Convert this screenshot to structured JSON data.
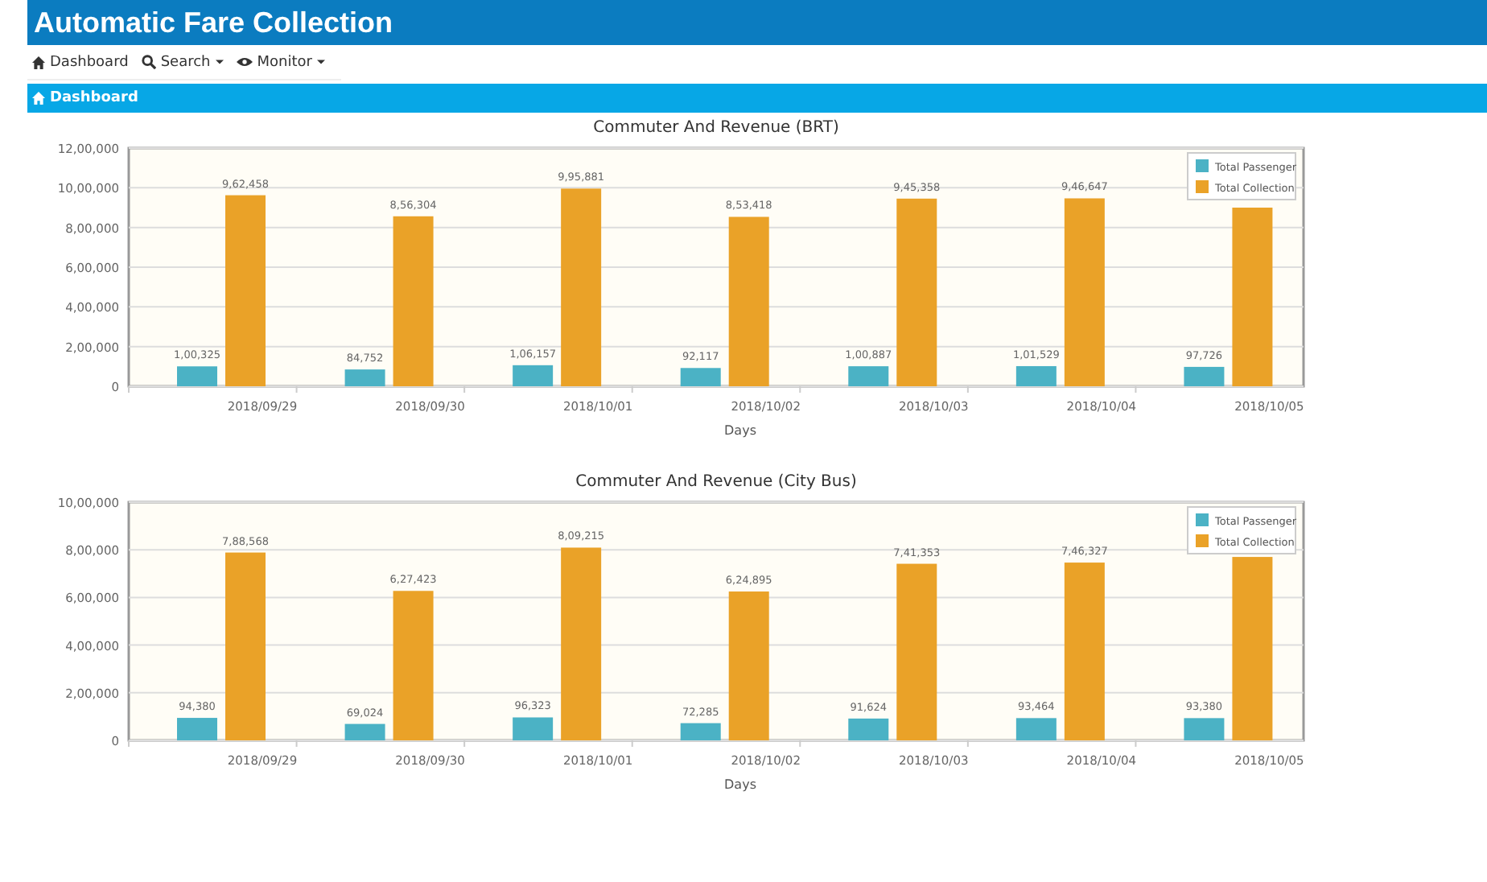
{
  "header": {
    "title": "Automatic Fare Collection"
  },
  "navbar": {
    "items": [
      {
        "label": "Dashboard",
        "dropdown": false
      },
      {
        "label": "Search",
        "dropdown": true
      },
      {
        "label": "Monitor",
        "dropdown": true
      }
    ]
  },
  "section_bar": {
    "title": "Dashboard"
  },
  "charts": [
    {
      "chart_data": {
        "type": "bar",
        "title": "Commuter And Revenue (BRT)",
        "xlabel": "Days",
        "categories": [
          "2018/09/29",
          "2018/09/30",
          "2018/10/01",
          "2018/10/02",
          "2018/10/03",
          "2018/10/04",
          "2018/10/05"
        ],
        "series": [
          {
            "name": "Total Passenger",
            "color": "#4bb2c5",
            "values": [
              100325,
              84752,
              106157,
              92117,
              100887,
              101529,
              97726
            ],
            "value_labels": [
              "1,00,325",
              "84,752",
              "1,06,157",
              "92,117",
              "1,00,887",
              "1,01,529",
              "97,726"
            ]
          },
          {
            "name": "Total Collection",
            "color": "#eaa228",
            "values": [
              962458,
              856304,
              995881,
              853418,
              945358,
              946647,
              900000
            ],
            "value_labels": [
              "9,62,458",
              "8,56,304",
              "9,95,881",
              "8,53,418",
              "9,45,358",
              "9,46,647",
              null
            ]
          }
        ],
        "grid": true,
        "legend": true,
        "ylim": [
          0,
          1200000
        ],
        "yticks": [
          {
            "value": 0,
            "label": "0"
          },
          {
            "value": 200000,
            "label": "2,00,000"
          },
          {
            "value": 400000,
            "label": "4,00,000"
          },
          {
            "value": 600000,
            "label": "6,00,000"
          },
          {
            "value": 800000,
            "label": "8,00,000"
          },
          {
            "value": 1000000,
            "label": "10,00,000"
          },
          {
            "value": 1200000,
            "label": "12,00,000"
          }
        ]
      }
    },
    {
      "chart_data": {
        "type": "bar",
        "title": "Commuter And Revenue (City Bus)",
        "xlabel": "Days",
        "categories": [
          "2018/09/29",
          "2018/09/30",
          "2018/10/01",
          "2018/10/02",
          "2018/10/03",
          "2018/10/04",
          "2018/10/05"
        ],
        "series": [
          {
            "name": "Total Passenger",
            "color": "#4bb2c5",
            "values": [
              94380,
              69024,
              96323,
              72285,
              91624,
              93464,
              93380
            ],
            "value_labels": [
              "94,380",
              "69,024",
              "96,323",
              "72,285",
              "91,624",
              "93,464",
              "93,380"
            ]
          },
          {
            "name": "Total Collection",
            "color": "#eaa228",
            "values": [
              788568,
              627423,
              809215,
              624895,
              741353,
              746327,
              770000
            ],
            "value_labels": [
              "7,88,568",
              "6,27,423",
              "8,09,215",
              "6,24,895",
              "7,41,353",
              "7,46,327",
              null
            ]
          }
        ],
        "grid": true,
        "legend": true,
        "ylim": [
          0,
          1000000
        ],
        "yticks": [
          {
            "value": 0,
            "label": "0"
          },
          {
            "value": 200000,
            "label": "2,00,000"
          },
          {
            "value": 400000,
            "label": "4,00,000"
          },
          {
            "value": 600000,
            "label": "6,00,000"
          },
          {
            "value": 800000,
            "label": "8,00,000"
          },
          {
            "value": 1000000,
            "label": "10,00,000"
          }
        ]
      }
    }
  ]
}
